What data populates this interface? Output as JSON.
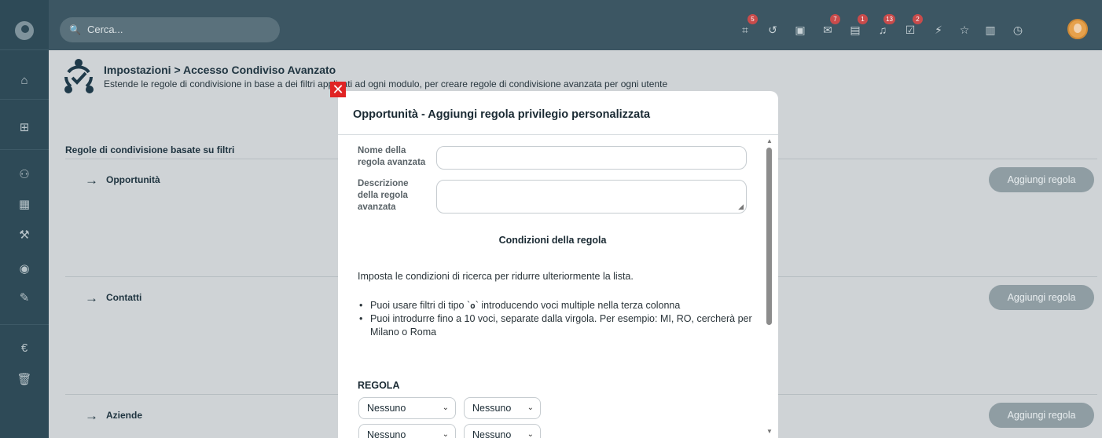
{
  "sidebar": {
    "icons": [
      "logo-icon",
      "home-icon",
      "grid-icon",
      "users-icon",
      "building-icon",
      "gavel-icon",
      "globe-icon",
      "wrench-icon",
      "euro-icon",
      "trash-icon"
    ]
  },
  "topbar": {
    "search_placeholder": "Cerca...",
    "icons": [
      {
        "name": "sitemap-icon",
        "glyph": "⌗",
        "badge": "5"
      },
      {
        "name": "history-icon",
        "glyph": "↺",
        "badge": ""
      },
      {
        "name": "calendar-icon",
        "glyph": "▣",
        "badge": ""
      },
      {
        "name": "mail-icon",
        "glyph": "✉",
        "badge": "7"
      },
      {
        "name": "chat-icon",
        "glyph": "▤",
        "badge": "1"
      },
      {
        "name": "bell-icon",
        "glyph": "♫",
        "badge": "13"
      },
      {
        "name": "tasks-icon",
        "glyph": "☑",
        "badge": "2"
      },
      {
        "name": "bolt-icon",
        "glyph": "⚡",
        "badge": ""
      },
      {
        "name": "star-icon",
        "glyph": "☆",
        "badge": ""
      },
      {
        "name": "document-icon",
        "glyph": "▥",
        "badge": ""
      },
      {
        "name": "timer-icon",
        "glyph": "◷",
        "badge": ""
      }
    ]
  },
  "header": {
    "title": "Impostazioni > Accesso Condiviso Avanzato",
    "subtitle": "Estende le regole di condivisione in base a dei filtri applicati ad ogni modulo, per creare regole di condivisione avanzata per ogni utente"
  },
  "main": {
    "section_title": "Regole di condivisione basate su filtri",
    "groups": [
      {
        "label": "Opportunità",
        "button": "Aggiungi regola"
      },
      {
        "label": "Contatti",
        "button": "Aggiungi regola"
      },
      {
        "label": "Aziende",
        "button": "Aggiungi regola"
      }
    ]
  },
  "modal": {
    "title": "Opportunità - Aggiungi regola privilegio personalizzata",
    "name_label": "Nome della regola avanzata",
    "name_value": "",
    "desc_label": "Descrizione della regola avanzata",
    "desc_value": "",
    "conditions_title": "Condizioni della regola",
    "conditions_intro": "Imposta le condizioni di ricerca per ridurre ulteriormente la lista.",
    "bullet1_pre": "Puoi usare filtri di tipo `",
    "bullet1_code": "o",
    "bullet1_post": "` introducendo voci multiple nella terza colonna",
    "bullet2": "Puoi introdurre fino a 10 voci, separate dalla virgola. Per esempio: MI, RO, cercherà per Milano o Roma",
    "rule_heading": "REGOLA",
    "select1": "Nessuno",
    "select2": "Nessuno",
    "select3": "Nessuno",
    "select4": "Nessuno"
  }
}
